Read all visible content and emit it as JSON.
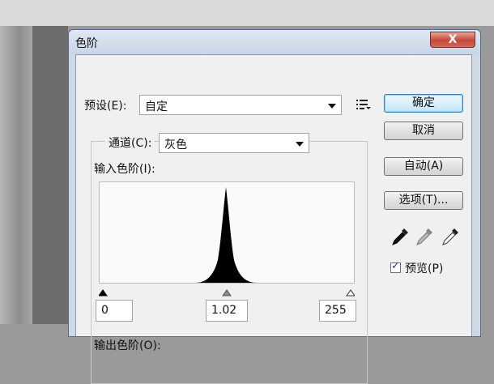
{
  "dialog": {
    "title": "色阶",
    "close_label": "X"
  },
  "preset": {
    "label": "预设(E):",
    "value": "自定"
  },
  "channel": {
    "label": "通道(C):",
    "value": "灰色"
  },
  "input_levels": {
    "label": "输入色阶(I):",
    "black": "0",
    "gamma": "1.02",
    "white": "255"
  },
  "output_levels": {
    "label": "输出色阶(O):"
  },
  "buttons": {
    "ok": "确定",
    "cancel": "取消",
    "auto": "自动(A)",
    "options": "选项(T)..."
  },
  "preview": {
    "label": "预览(P)",
    "checked": true
  },
  "icons": {
    "preset_menu": "list-menu-icon",
    "black_point": "black-eyedropper-icon",
    "gray_point": "gray-eyedropper-icon",
    "white_point": "white-eyedropper-icon"
  },
  "histogram": {
    "peak_level": 128,
    "spread": "narrow"
  }
}
